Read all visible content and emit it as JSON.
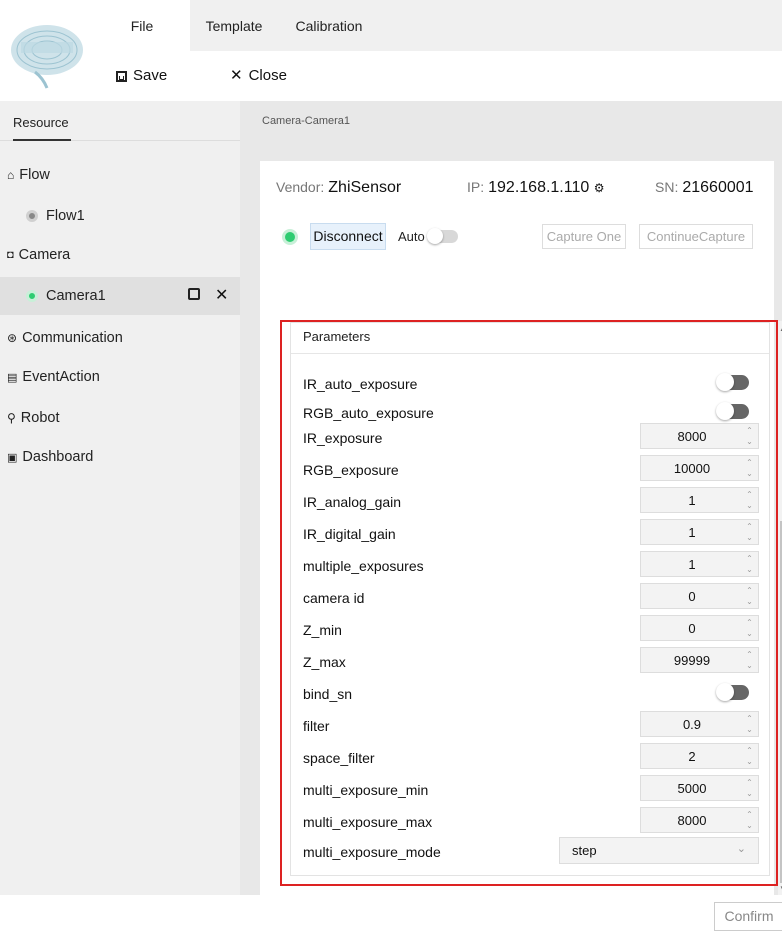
{
  "menu": {
    "file": "File",
    "template": "Template",
    "calibration": "Calibration"
  },
  "toolbar": {
    "save": "Save",
    "close": "Close"
  },
  "sidebar": {
    "tab": "Resource",
    "groups": {
      "flow": "Flow",
      "flow1": "Flow1",
      "camera": "Camera",
      "camera1": "Camera1",
      "communication": "Communication",
      "eventaction": "EventAction",
      "robot": "Robot",
      "dashboard": "Dashboard"
    }
  },
  "breadcrumb": "Camera-Camera1",
  "device": {
    "vendor_label": "Vendor:",
    "vendor": "ZhiSensor",
    "ip_label": "IP:",
    "ip": "192.168.1.110",
    "sn_label": "SN:",
    "sn": "21660001"
  },
  "controls": {
    "disconnect": "Disconnect",
    "auto": "Auto",
    "capture_one": "Capture One",
    "continue_capture": "ContinueCapture",
    "confirm": "Confirm"
  },
  "parameters": {
    "title": "Parameters",
    "rows": [
      {
        "label": "IR_auto_exposure",
        "type": "toggle",
        "on": false
      },
      {
        "label": "RGB_auto_exposure",
        "type": "toggle",
        "on": false
      },
      {
        "label": "IR_exposure",
        "type": "number",
        "value": "8000"
      },
      {
        "label": "RGB_exposure",
        "type": "number",
        "value": "10000"
      },
      {
        "label": "IR_analog_gain",
        "type": "number",
        "value": "1"
      },
      {
        "label": "IR_digital_gain",
        "type": "number",
        "value": "1"
      },
      {
        "label": "multiple_exposures",
        "type": "number",
        "value": "1"
      },
      {
        "label": "camera id",
        "type": "number",
        "value": "0"
      },
      {
        "label": "Z_min",
        "type": "number",
        "value": "0"
      },
      {
        "label": "Z_max",
        "type": "number",
        "value": "99999"
      },
      {
        "label": "bind_sn",
        "type": "toggle",
        "on": false
      },
      {
        "label": "filter",
        "type": "number",
        "value": "0.9"
      },
      {
        "label": "space_filter",
        "type": "number",
        "value": "2"
      },
      {
        "label": "multi_exposure_min",
        "type": "number",
        "value": "5000"
      },
      {
        "label": "multi_exposure_max",
        "type": "number",
        "value": "8000"
      },
      {
        "label": "multi_exposure_mode",
        "type": "select",
        "value": "step"
      }
    ]
  },
  "colors": {
    "connected": "#2ecc71",
    "highlight_border": "#dd2222"
  }
}
